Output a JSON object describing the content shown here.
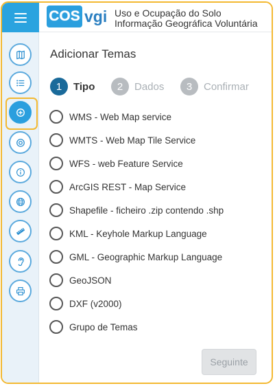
{
  "header": {
    "logo_text": "COS",
    "logo_suffix": "vgi",
    "title_line1": "Uso e Ocupação do Solo",
    "title_line2": "Informação Geográfica Voluntária"
  },
  "sidebar": {
    "items": [
      {
        "name": "map-icon",
        "active": false
      },
      {
        "name": "list-icon",
        "active": false
      },
      {
        "name": "add-circle-icon",
        "active": true
      },
      {
        "name": "target-icon",
        "active": false
      },
      {
        "name": "info-icon",
        "active": false
      },
      {
        "name": "globe-icon",
        "active": false
      },
      {
        "name": "ruler-icon",
        "active": false
      },
      {
        "name": "ear-icon",
        "active": false
      },
      {
        "name": "print-icon",
        "active": false
      }
    ]
  },
  "panel": {
    "title": "Adicionar Temas",
    "steps": [
      {
        "number": "1",
        "label": "Tipo",
        "active": true
      },
      {
        "number": "2",
        "label": "Dados",
        "active": false
      },
      {
        "number": "3",
        "label": "Confirmar",
        "active": false
      }
    ],
    "options": [
      "WMS - Web Map service",
      "WMTS - Web Map Tile Service",
      "WFS - web Feature Service",
      "ArcGIS REST - Map Service",
      "Shapefile - ficheiro .zip contendo .shp",
      "KML - Keyhole Markup Language",
      "GML - Geographic Markup Language",
      "GeoJSON",
      "DXF (v2000)",
      "Grupo de Temas"
    ],
    "next_label": "Seguinte"
  },
  "colors": {
    "accent": "#2b9fde",
    "highlight": "#f3b830",
    "step_active": "#1a6a9a",
    "step_inactive": "#b8bcc0"
  }
}
